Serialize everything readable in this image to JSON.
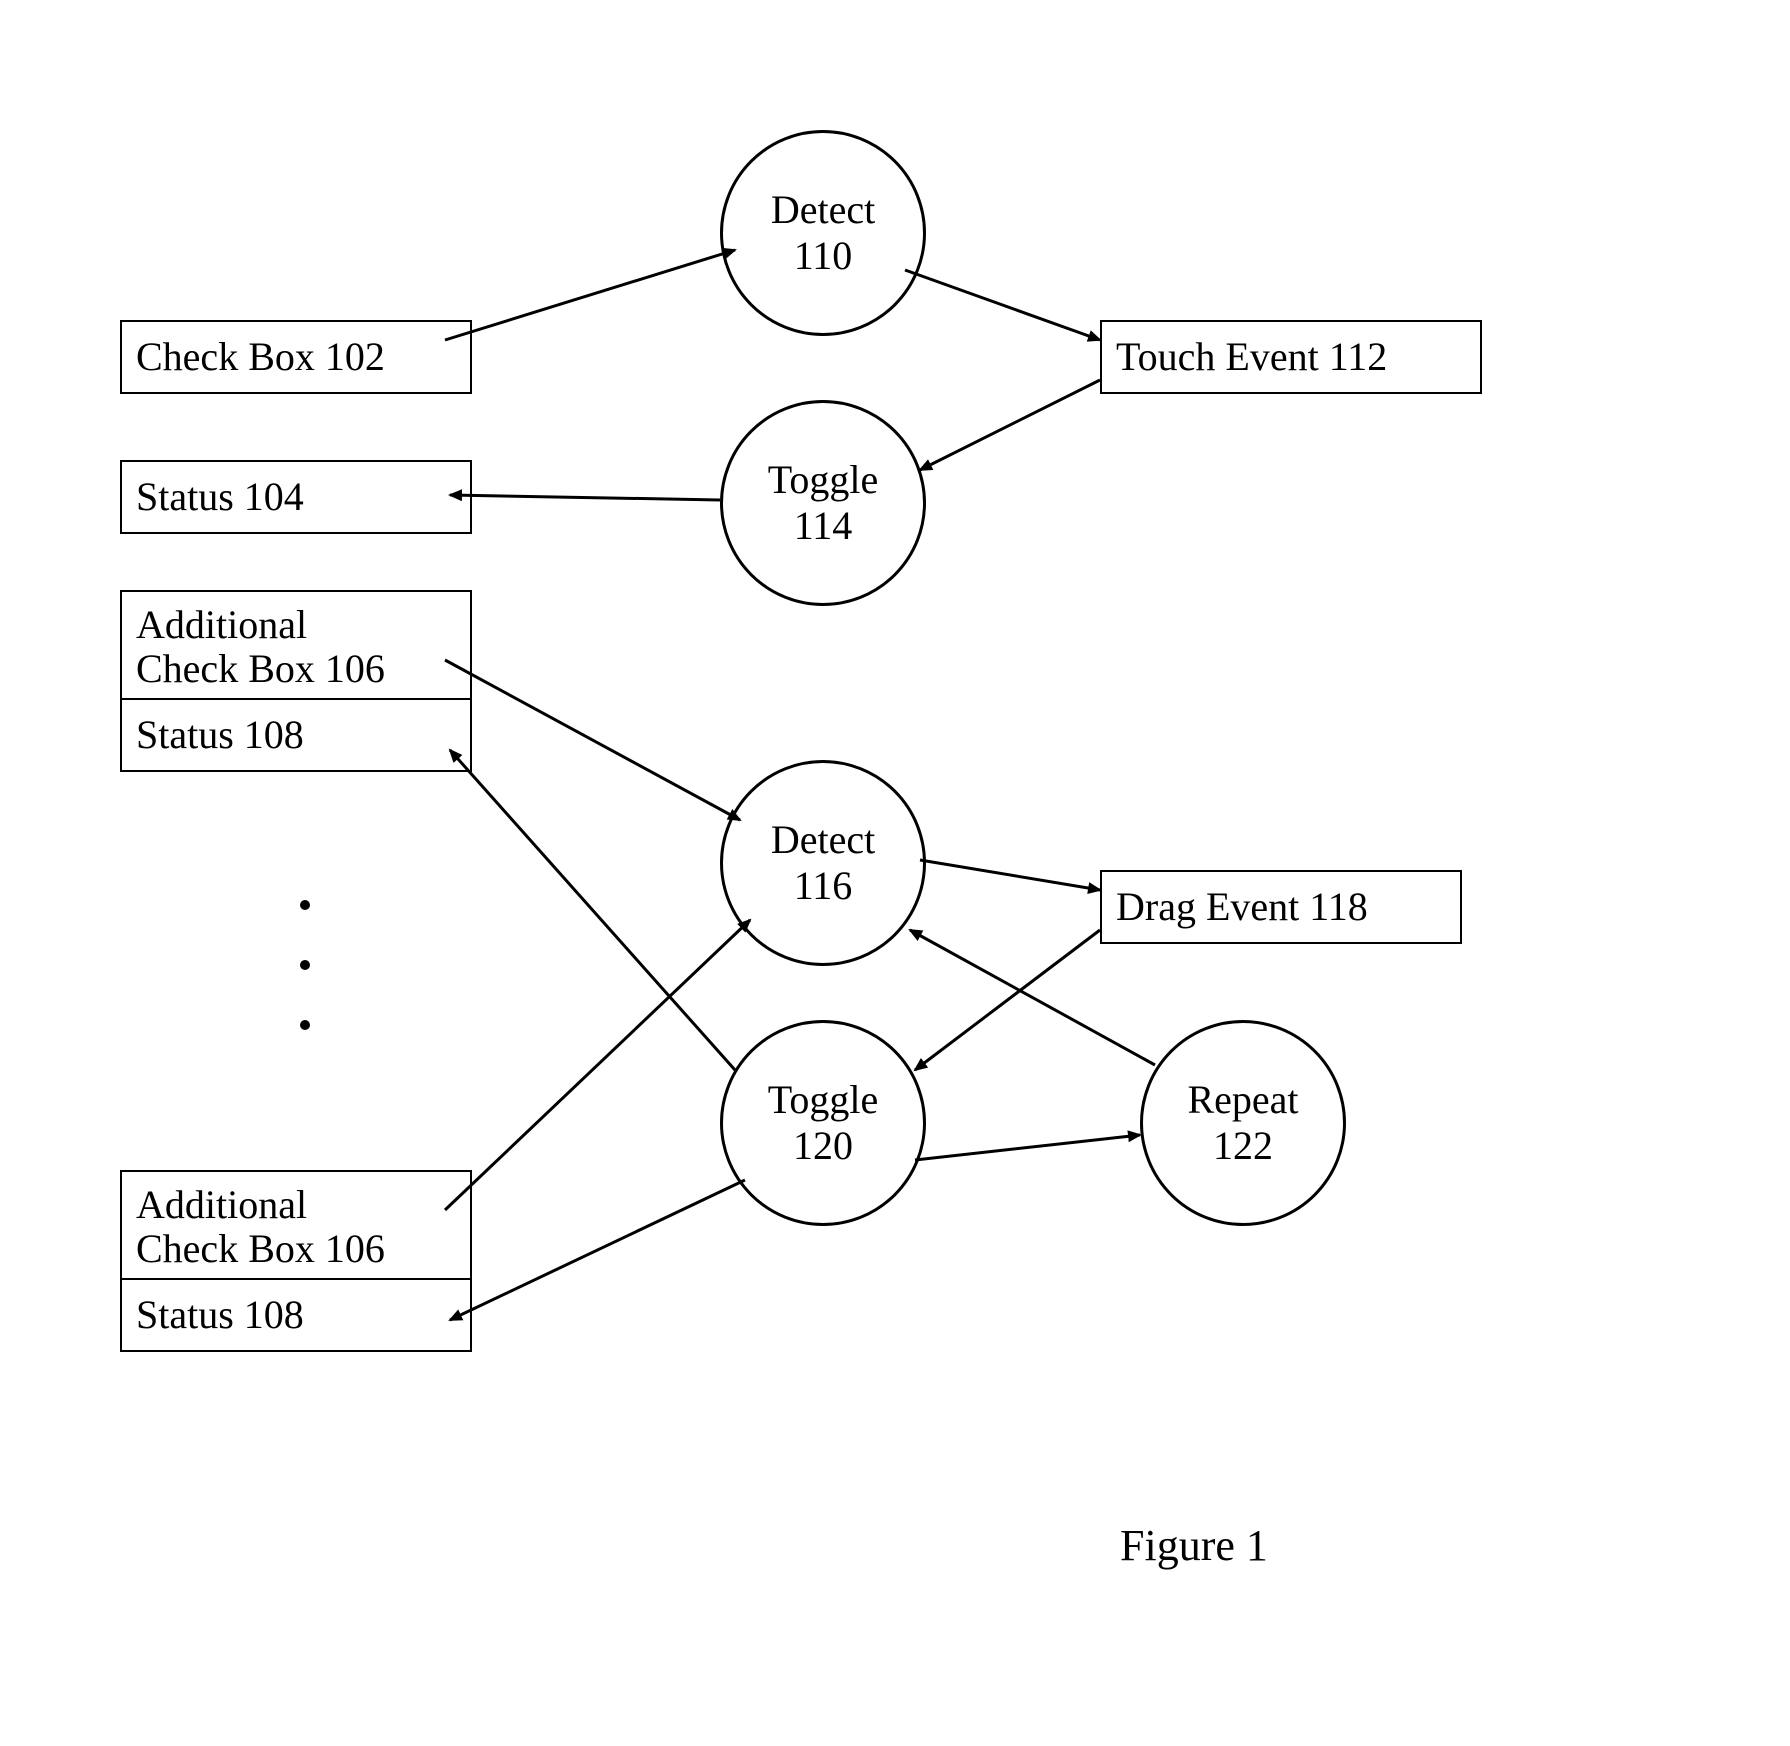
{
  "nodes": {
    "check_box_102": {
      "label": "Check Box 102"
    },
    "status_104": {
      "label": "Status 104"
    },
    "detect_110": {
      "label1": "Detect",
      "label2": "110"
    },
    "toggle_114": {
      "label1": "Toggle",
      "label2": "114"
    },
    "touch_event_112": {
      "label": "Touch Event 112"
    },
    "add_cb_106a": {
      "label1": "Additional",
      "label2": "Check Box 106"
    },
    "status_108a": {
      "label": "Status 108"
    },
    "add_cb_106b": {
      "label1": "Additional",
      "label2": "Check Box 106"
    },
    "status_108b": {
      "label": "Status 108"
    },
    "detect_116": {
      "label1": "Detect",
      "label2": "116"
    },
    "toggle_120": {
      "label1": "Toggle",
      "label2": "120"
    },
    "drag_event_118": {
      "label": "Drag Event 118"
    },
    "repeat_122": {
      "label1": "Repeat",
      "label2": "122"
    }
  },
  "caption": "Figure 1"
}
